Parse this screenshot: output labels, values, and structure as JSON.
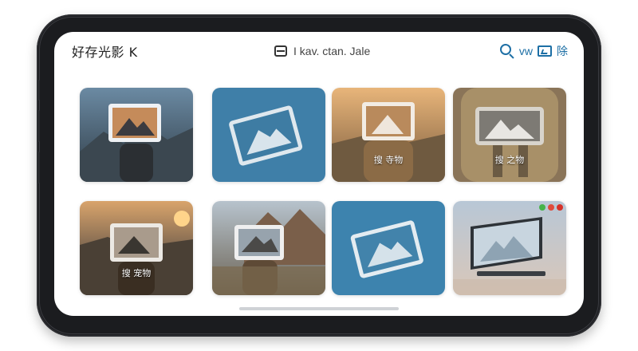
{
  "header": {
    "app_title": "好存光影 K",
    "center_label": "I kav. ctan. Jale",
    "right_label": "vw",
    "right_label2": "除"
  },
  "cards": [
    {
      "caption": ""
    },
    {
      "caption": ""
    },
    {
      "caption": "搜 寺物"
    },
    {
      "caption": "搜 之物"
    },
    {
      "caption": "搜 宠物"
    },
    {
      "caption": ""
    },
    {
      "caption": ""
    },
    {
      "caption": ""
    }
  ],
  "icons": {
    "menu": "menu-icon",
    "search": "search-zoom-icon",
    "export": "export-icon",
    "placeholder": "image-placeholder-icon"
  },
  "colors": {
    "accent": "#1d6fa5",
    "frame": "#1b1c1f",
    "blue_card": "#3f7fa8"
  }
}
